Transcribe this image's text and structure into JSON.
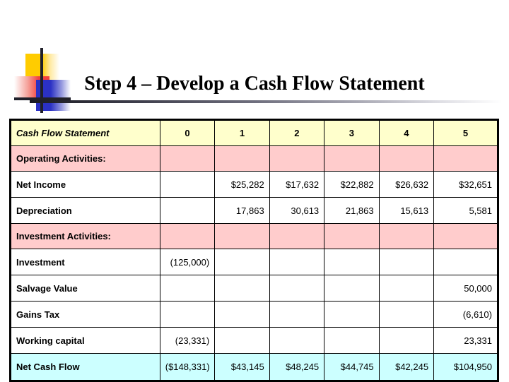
{
  "slide": {
    "title": "Step 4 – Develop a Cash Flow Statement",
    "logo": {
      "yellow": "#ffcc00",
      "red": "#f2413c",
      "blue": "#2b31c4",
      "bar": "#20202a"
    },
    "colors": {
      "header_bg": "#ffffcc",
      "section_bg": "#ffcccc",
      "total_bg": "#ccffff",
      "section_text": "#3333cc",
      "border": "#000000"
    }
  },
  "table": {
    "header": {
      "label": "Cash Flow Statement",
      "periods": [
        "0",
        "1",
        "2",
        "3",
        "4",
        "5"
      ]
    },
    "rows": [
      {
        "kind": "section",
        "label": "Operating Activities:",
        "values": [
          "",
          "",
          "",
          "",
          "",
          ""
        ]
      },
      {
        "kind": "item",
        "label": "Net Income",
        "values": [
          "",
          "$25,282",
          "$17,632",
          "$22,882",
          "$26,632",
          "$32,651"
        ]
      },
      {
        "kind": "item",
        "label": "Depreciation",
        "values": [
          "",
          "17,863",
          "30,613",
          "21,863",
          "15,613",
          "5,581"
        ]
      },
      {
        "kind": "section",
        "label": "Investment Activities:",
        "values": [
          "",
          "",
          "",
          "",
          "",
          ""
        ]
      },
      {
        "kind": "item",
        "label": "Investment",
        "values": [
          "(125,000)",
          "",
          "",
          "",
          "",
          ""
        ]
      },
      {
        "kind": "item",
        "label": "Salvage Value",
        "values": [
          "",
          "",
          "",
          "",
          "",
          "50,000"
        ]
      },
      {
        "kind": "item",
        "label": "Gains Tax",
        "values": [
          "",
          "",
          "",
          "",
          "",
          "(6,610)"
        ]
      },
      {
        "kind": "item",
        "label": "Working capital",
        "values": [
          "(23,331)",
          "",
          "",
          "",
          "",
          "23,331"
        ]
      },
      {
        "kind": "total",
        "label": "Net Cash Flow",
        "values": [
          "($148,331)",
          "$43,145",
          "$48,245",
          "$44,745",
          "$42,245",
          "$104,950"
        ]
      }
    ]
  }
}
